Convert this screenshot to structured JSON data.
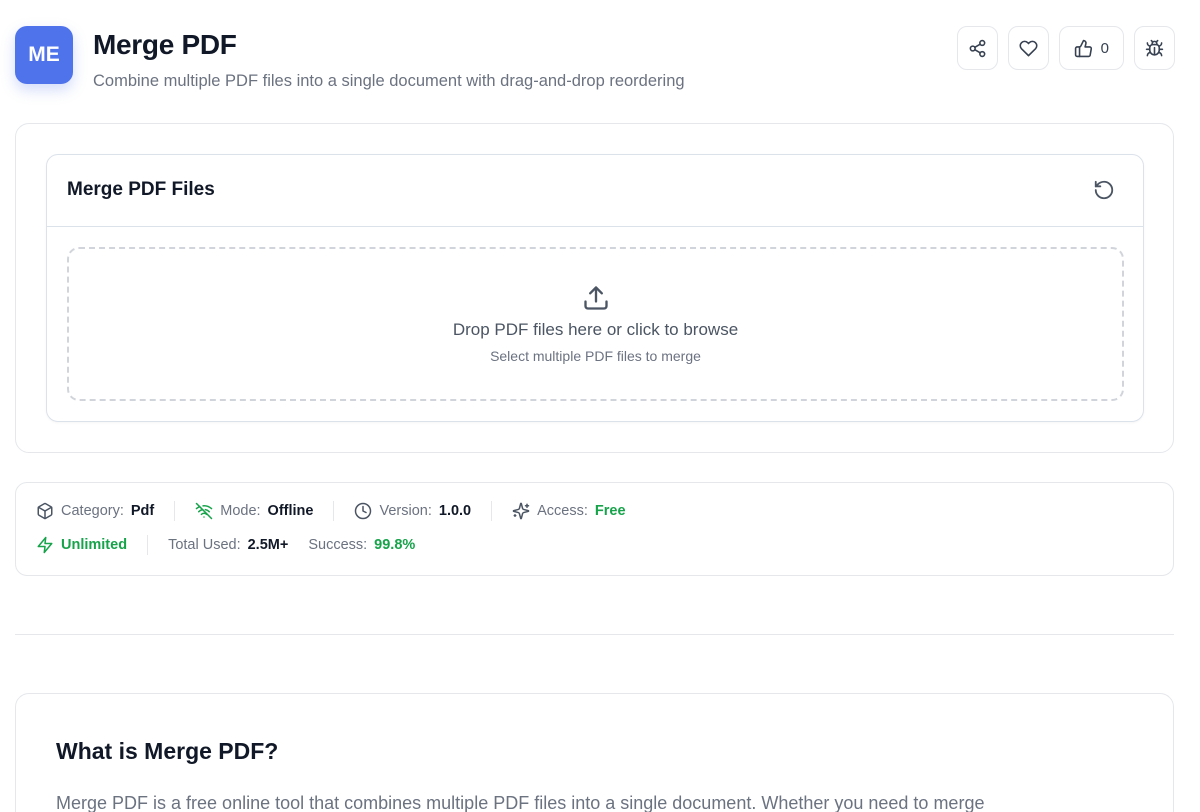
{
  "header": {
    "logo_text": "ME",
    "title": "Merge PDF",
    "subtitle": "Combine multiple PDF files into a single document with drag-and-drop reordering",
    "like_count": "0",
    "actions": [
      "share-icon",
      "heart-icon",
      "thumbs-up-icon",
      "bug-icon"
    ]
  },
  "tool": {
    "title": "Merge PDF Files",
    "reset_icon": "reset-icon",
    "dropzone": {
      "icon": "upload-icon",
      "main": "Drop PDF files here or click to browse",
      "sub": "Select multiple PDF files to merge"
    }
  },
  "meta": {
    "category_label": "Category:",
    "category_value": "Pdf",
    "mode_label": "Mode:",
    "mode_value": "Offline",
    "version_label": "Version:",
    "version_value": "1.0.0",
    "access_label": "Access:",
    "access_value": "Free",
    "unlimited": "Unlimited",
    "total_label": "Total Used:",
    "total_value": "2.5M+",
    "success_label": "Success:",
    "success_value": "99.8%"
  },
  "about": {
    "title": "What is Merge PDF?",
    "text": "Merge PDF is a free online tool that combines multiple PDF files into a single document. Whether you need to merge"
  },
  "colors": {
    "accent": "#4f73ea",
    "success": "#16a34a"
  }
}
